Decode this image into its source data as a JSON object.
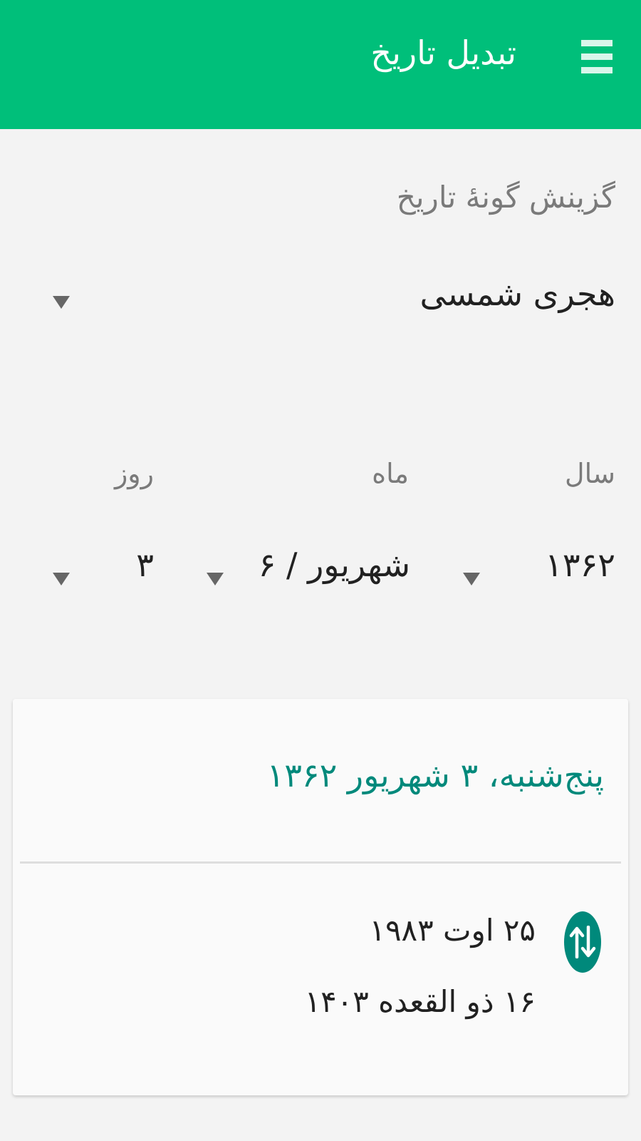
{
  "appbar": {
    "title": "تبدیل تاریخ",
    "menu_icon": "hamburger-menu-icon",
    "color": "#00bf7a"
  },
  "calendar_type": {
    "label": "گزینش گونهٔ تاریخ",
    "selected": "هجری شمسی"
  },
  "date_fields": {
    "year": {
      "label": "سال",
      "value": "۱۳۶۲"
    },
    "month": {
      "label": "ماه",
      "value": "شهریور / ۶"
    },
    "day": {
      "label": "روز",
      "value": "۳"
    }
  },
  "result_card": {
    "title": "پنج‌شنبه، ۳ شهریور ۱۳۶۲",
    "swap_icon": "swap-vertical-icon",
    "accent": "#00897b",
    "gregorian": "۲۵ اوت ۱۹۸۳",
    "hijri": "۱۶ ذو القعده ۱۴۰۳"
  }
}
